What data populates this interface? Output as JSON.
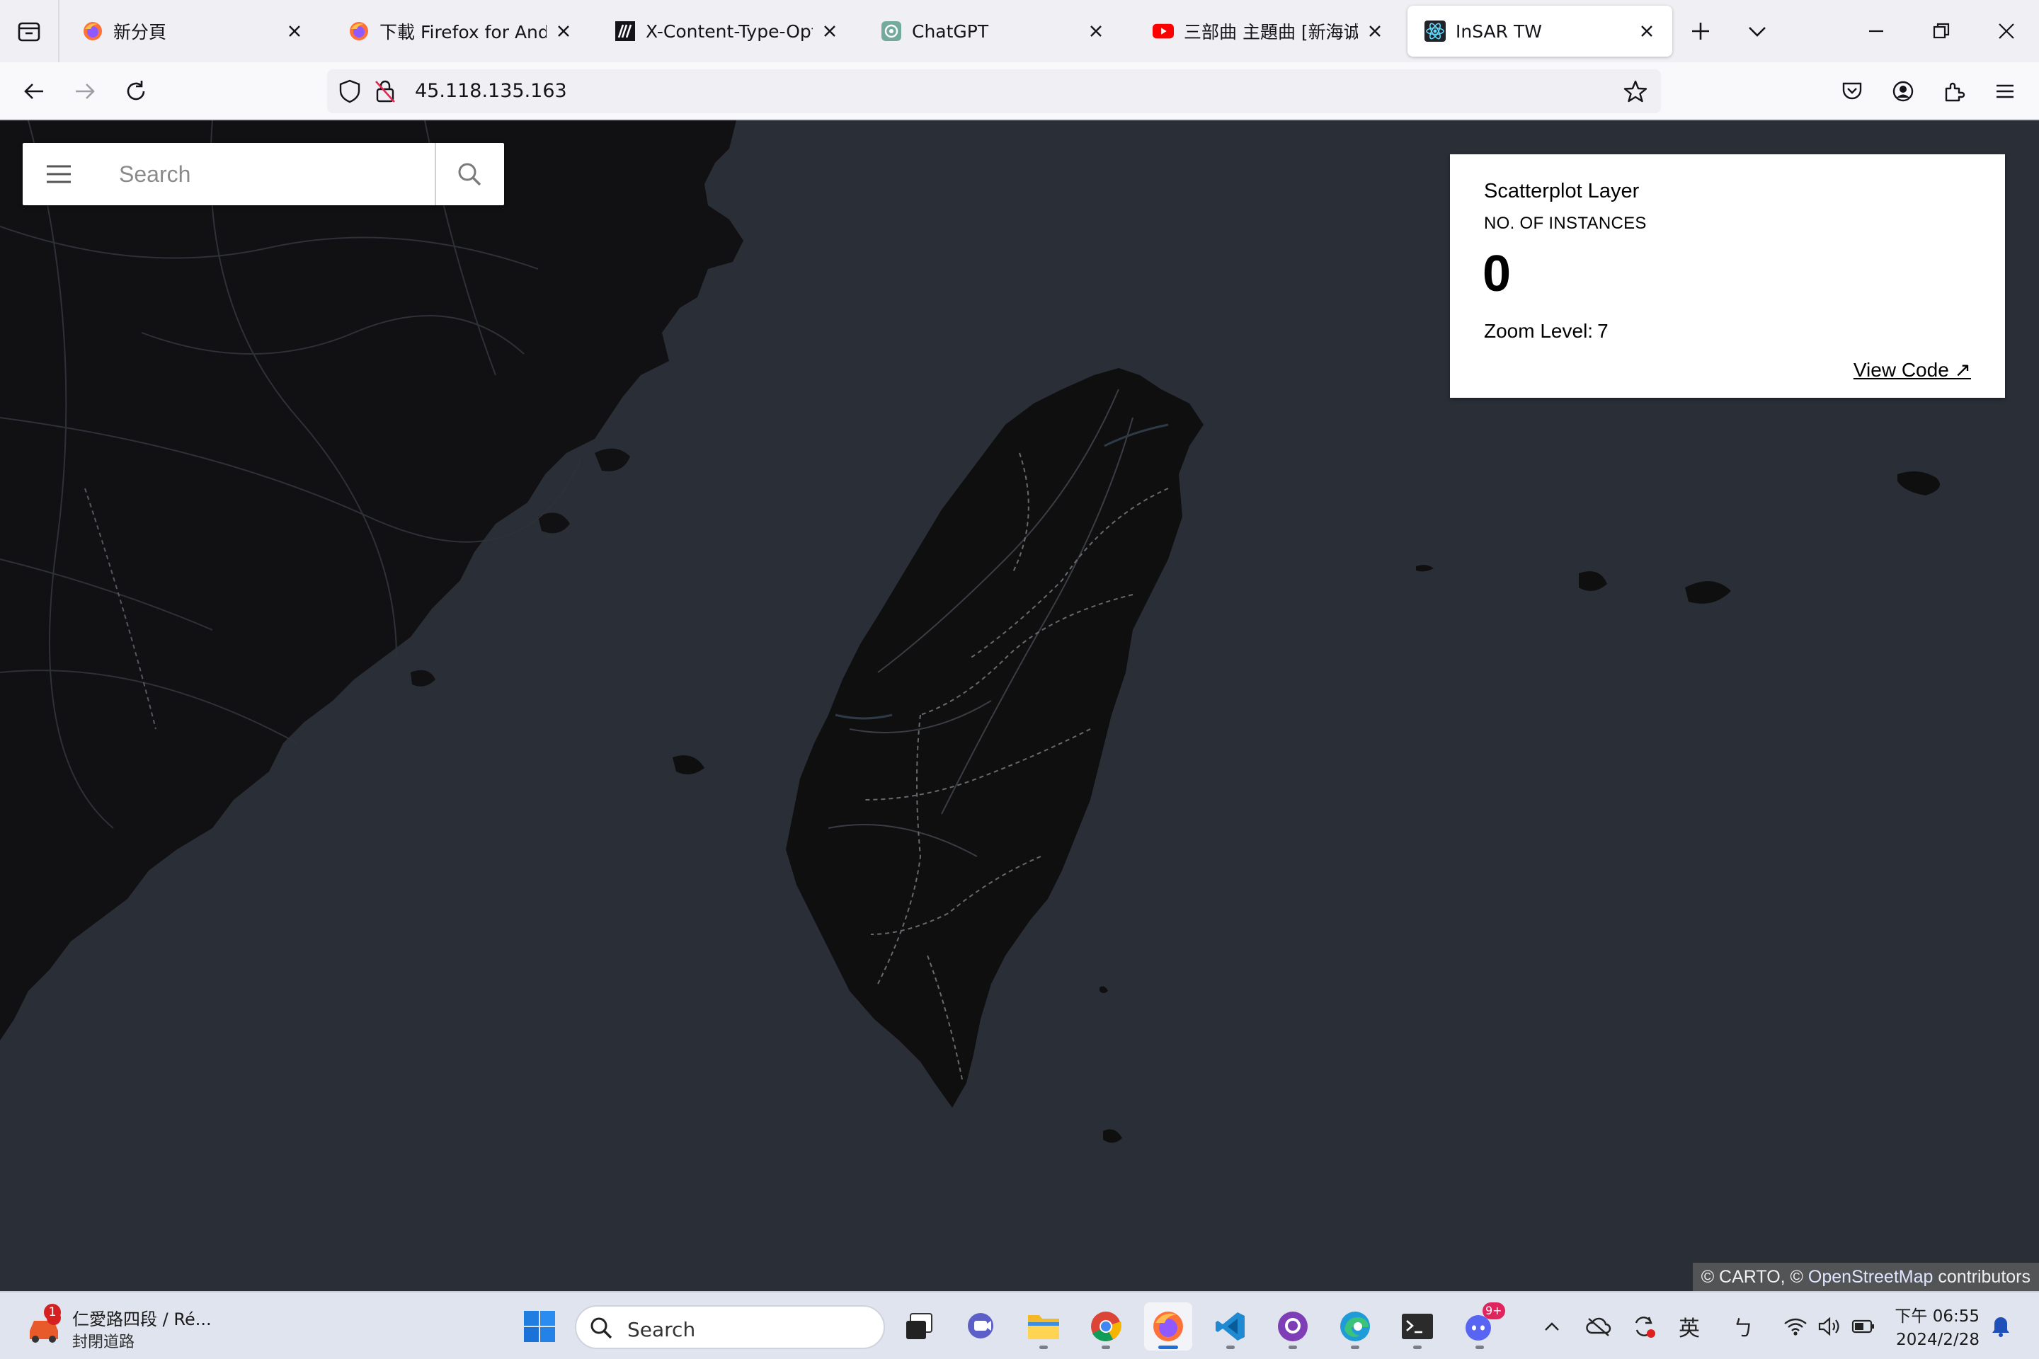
{
  "browser": {
    "tabs": [
      {
        "title": "新分頁",
        "icon": "firefox-icon",
        "active": false
      },
      {
        "title": "下載 Firefox for Android",
        "icon": "firefox-icon",
        "active": false
      },
      {
        "title": "X-Content-Type-Options",
        "icon": "mdn-icon",
        "active": false
      },
      {
        "title": "ChatGPT",
        "icon": "chatgpt-icon",
        "active": false
      },
      {
        "title": "三部曲 主題曲 [新海诚] Γ",
        "icon": "youtube-icon",
        "active": false
      },
      {
        "title": "InSAR TW",
        "icon": "react-icon",
        "active": true
      }
    ],
    "url": "45.118.135.163"
  },
  "map": {
    "search": {
      "placeholder": "Search"
    },
    "panel": {
      "layer_title": "Scatterplot Layer",
      "instances_label": "NO. OF INSTANCES",
      "instances_count": "0",
      "zoom_label": "Zoom Level:",
      "zoom_value": "7",
      "view_code": "View Code ↗"
    },
    "attribution": {
      "carto": "© CARTO, ©",
      "osm": "OpenStreetMap",
      "contributors": "contributors"
    },
    "colors": {
      "water": "#2a2f37",
      "land": "#0f0f10",
      "roads": "#3a3d44"
    }
  },
  "taskbar": {
    "notification": {
      "line1": "仁愛路四段 / Ré...",
      "line2": "封閉道路",
      "badge": "1"
    },
    "search_label": "Search",
    "discord_badge": "9+",
    "ime_1": "英",
    "ime_2": "ㄅ",
    "time": "下午 06:55",
    "date": "2024/2/28"
  }
}
